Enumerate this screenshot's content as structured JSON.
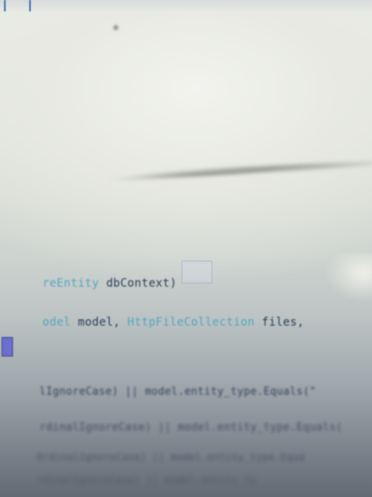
{
  "colors": {
    "identifier": "#2d3c58",
    "type_keyword": "#53a6bf",
    "dim_keyword": "#6f8aa6",
    "marker": "#6b6fd0",
    "accent": "#3d6fb0"
  },
  "code": {
    "line1": {
      "type_fragment": "reEntity",
      "rest": " dbContext)"
    },
    "line2": {
      "type_fragment": "odel",
      "param": " model, ",
      "type2": "HttpFileCollection",
      "rest": " files,"
    },
    "line4": {
      "text": "lIgnoreCase) || model.entity_type.Equals(\""
    },
    "line5": {
      "text": "rdinalIgnoreCase) || model.entity_type.Equals("
    },
    "line6": {
      "text": "OrdinalIgnoreCase) || model.entity_type.Equa"
    },
    "line7": {
      "text": "rdinalIgnoreCase) || model.entity_ty"
    }
  },
  "icons": {
    "gutter_marker": "bookmark-icon"
  }
}
